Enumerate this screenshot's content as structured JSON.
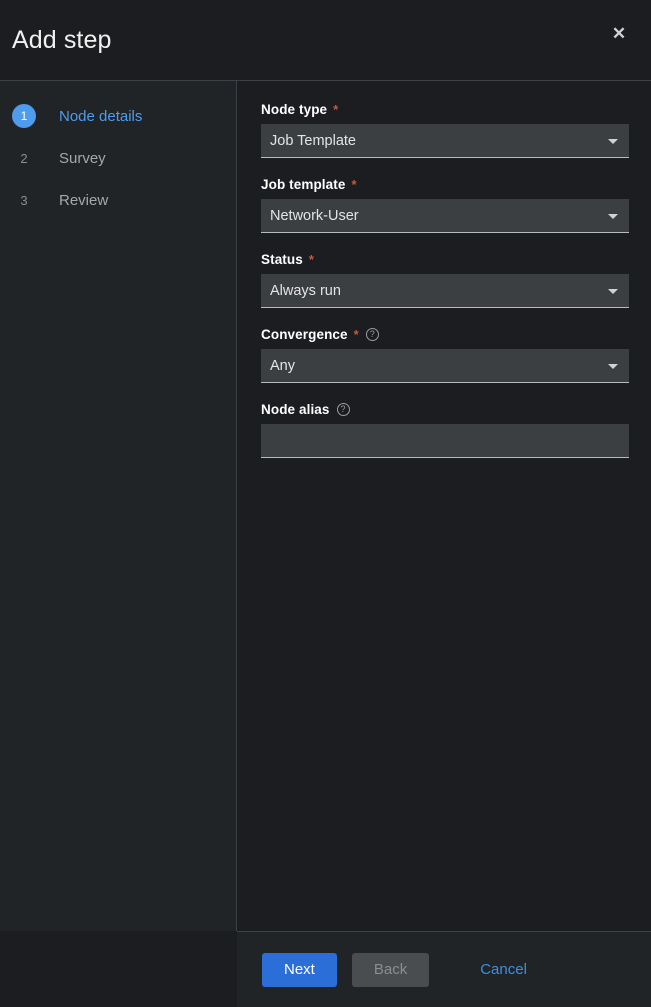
{
  "header": {
    "title": "Add step",
    "close_label": "✕"
  },
  "sidebar": {
    "items": [
      {
        "number": "1",
        "label": "Node details",
        "active": true
      },
      {
        "number": "2",
        "label": "Survey",
        "active": false
      },
      {
        "number": "3",
        "label": "Review",
        "active": false
      }
    ]
  },
  "form": {
    "fields": [
      {
        "label": "Node type",
        "required": "*",
        "value": "Job Template",
        "help": ""
      },
      {
        "label": "Job template",
        "required": "*",
        "value": "Network-User",
        "help": ""
      },
      {
        "label": "Status",
        "required": "*",
        "value": "Always run",
        "help": ""
      },
      {
        "label": "Convergence",
        "required": "*",
        "value": "Any",
        "help": "?"
      },
      {
        "label": "Node alias",
        "required": "",
        "value": "",
        "placeholder": "",
        "help": "?"
      }
    ]
  },
  "footer": {
    "next_label": "Next",
    "back_label": "Back",
    "cancel_label": "Cancel"
  },
  "colors": {
    "accent_blue": "#2b6ed8",
    "link_blue": "#3e8ee0",
    "step_active": "#4f9bec",
    "required_asterisk": "#c9573c",
    "panel_bg": "#1b1d21",
    "sidebar_bg": "#212427",
    "control_bg": "#3c3f42"
  }
}
